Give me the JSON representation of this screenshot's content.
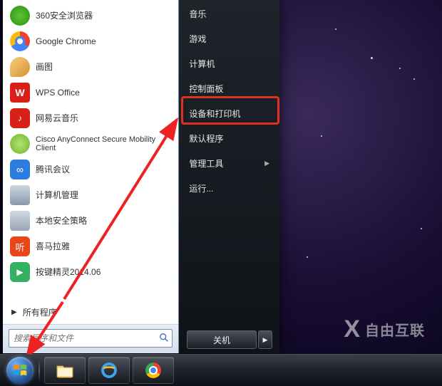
{
  "left_apps": [
    {
      "label": "360安全浏览器",
      "icon": "360-icon"
    },
    {
      "label": "Google Chrome",
      "icon": "chrome-icon"
    },
    {
      "label": "画图",
      "icon": "paint-icon"
    },
    {
      "label": "WPS Office",
      "icon": "wps-icon"
    },
    {
      "label": "网易云音乐",
      "icon": "netease-icon"
    },
    {
      "label": "Cisco AnyConnect Secure Mobility Client",
      "icon": "cisco-icon",
      "two_line": true
    },
    {
      "label": "腾讯会议",
      "icon": "tencent-meeting-icon"
    },
    {
      "label": "计算机管理",
      "icon": "computer-mgmt-icon"
    },
    {
      "label": "本地安全策略",
      "icon": "secpol-icon"
    },
    {
      "label": "喜马拉雅",
      "icon": "ximalaya-icon"
    },
    {
      "label": "按键精灵2014.06",
      "icon": "keyspirit-icon"
    }
  ],
  "all_programs_label": "所有程序",
  "search": {
    "placeholder": "搜索程序和文件"
  },
  "right_items": [
    {
      "label": "音乐",
      "submenu": false
    },
    {
      "label": "游戏",
      "submenu": false
    },
    {
      "label": "计算机",
      "submenu": false
    },
    {
      "label": "控制面板",
      "submenu": false
    },
    {
      "label": "设备和打印机",
      "submenu": false,
      "highlighted": true
    },
    {
      "label": "默认程序",
      "submenu": false
    },
    {
      "label": "管理工具",
      "submenu": true
    },
    {
      "label": "运行...",
      "submenu": false
    }
  ],
  "shutdown_label": "关机",
  "watermark_text": "自由互联",
  "annotation": {
    "highlight_target": "设备和打印机",
    "arrows": [
      "to-highlight",
      "to-start-orb"
    ]
  }
}
